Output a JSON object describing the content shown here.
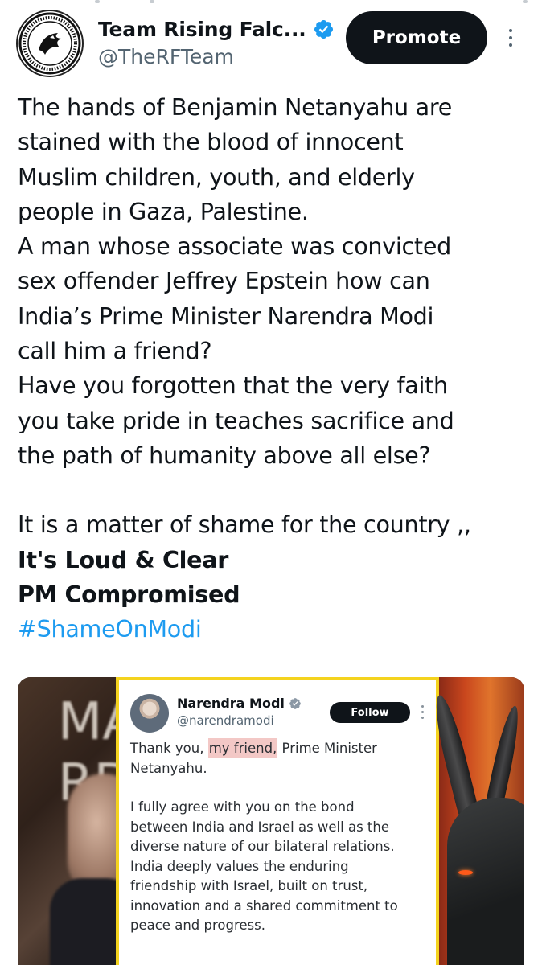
{
  "author": {
    "display_name": "Team Rising Falc...",
    "handle": "@TheRFTeam",
    "avatar_icon": "rising-falcon-logo-icon",
    "verified_icon": "verified-badge-icon",
    "verified_color": "#1d9bf0"
  },
  "actions": {
    "promote_label": "Promote",
    "more_icon": "more-vertical-icon"
  },
  "tweet": {
    "lines": [
      "The hands of Benjamin Netanyahu are",
      "stained with the blood of innocent",
      "Muslim children, youth, and elderly",
      "people in Gaza, Palestine.",
      "A man whose associate was convicted",
      "sex offender Jeffrey Epstein  how can",
      "India’s Prime Minister Narendra Modi",
      "call him a friend?",
      "Have you forgotten that the very faith",
      "you take pride in teaches sacrifice and",
      "the path of humanity above all else?"
    ],
    "line_shame": "It is a matter of shame for the country ,,",
    "bold_lines": [
      "It's Loud & Clear",
      "PM Compromised"
    ],
    "hashtag": "#ShameOnModi",
    "hashtag_color": "#1d9bf0"
  },
  "media": {
    "left_panel_text": [
      "MA",
      "RD"
    ],
    "embedded_post": {
      "name": "Narendra Modi",
      "handle": "@narendramodi",
      "follow_label": "Follow",
      "verified_color": "#8b98a5",
      "line1_pre": "Thank you, ",
      "line1_highlight": "my friend,",
      "line1_post": " Prime Minister",
      "line2": "Netanyahu.",
      "paragraph": [
        "I fully agree with you on the bond",
        "between India and Israel as well as the",
        "diverse nature of our bilateral relations.",
        "India deeply values the enduring",
        "friendship with Israel, built on trust,",
        "innovation and a shared commitment to",
        "peace and progress."
      ],
      "highlight_color": "#f3c8c6",
      "border_color": "#f4d31e"
    }
  }
}
